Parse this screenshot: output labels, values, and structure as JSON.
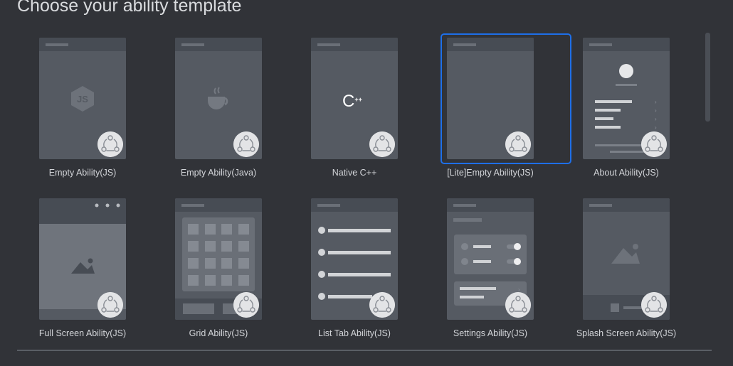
{
  "page": {
    "title": "Choose your ability template"
  },
  "templates": [
    {
      "label": "Empty Ability(JS)",
      "icon": "js-icon"
    },
    {
      "label": "Empty Ability(Java)",
      "icon": "java-coffee-icon"
    },
    {
      "label": "Native C++",
      "icon": "cpp-icon",
      "icon_text": "C",
      "icon_suffix": "++"
    },
    {
      "label": "[Lite]Empty Ability(JS)",
      "icon": "",
      "selected": true
    },
    {
      "label": "About Ability(JS)",
      "icon": "about-preview"
    },
    {
      "label": "Full Screen Ability(JS)",
      "icon": "image-icon"
    },
    {
      "label": "Grid Ability(JS)",
      "icon": "grid-preview"
    },
    {
      "label": "List Tab Ability(JS)",
      "icon": "list-preview"
    },
    {
      "label": "Settings Ability(JS)",
      "icon": "settings-preview"
    },
    {
      "label": "Splash Screen Ability(JS)",
      "icon": "splash-preview"
    }
  ],
  "colors": {
    "background": "#313338",
    "card": "#555a62",
    "card_header": "#474c54",
    "selection_border": "#1e6fe8",
    "badge": "#e3e4e6"
  }
}
